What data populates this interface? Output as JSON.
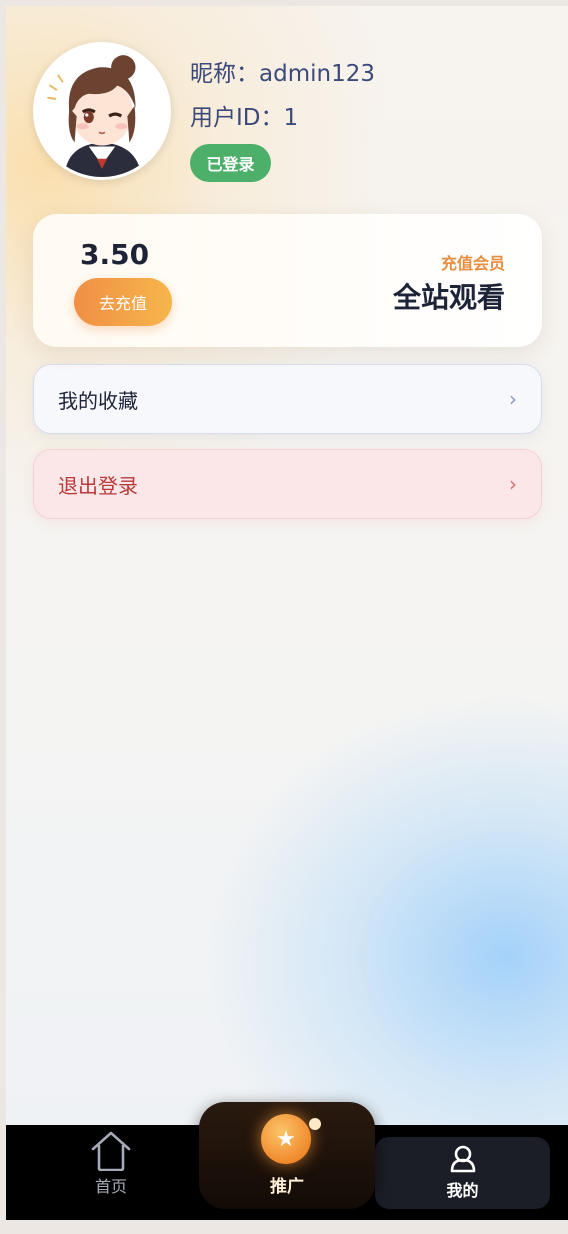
{
  "profile": {
    "nickname": "昵称：admin123",
    "user_id": "用户ID：1",
    "status_badge": "已登录"
  },
  "wallet": {
    "balance": "3.50",
    "recharge_button": "去充值",
    "vip_label": "充值会员",
    "vip_title": "全站观看"
  },
  "menu": {
    "favorites": "我的收藏",
    "logout": "退出登录",
    "arrow": "›"
  },
  "tabbar": {
    "home": "首页",
    "promo": "推广",
    "mine": "我的",
    "active": "mine"
  },
  "colors": {
    "badge": "#4caf6a",
    "recharge": "#f08f45",
    "vip_label": "#e98e40",
    "logout_text": "#b83a3a"
  },
  "icons": {
    "home": "house-icon",
    "promo": "star-icon",
    "mine": "user-icon"
  }
}
